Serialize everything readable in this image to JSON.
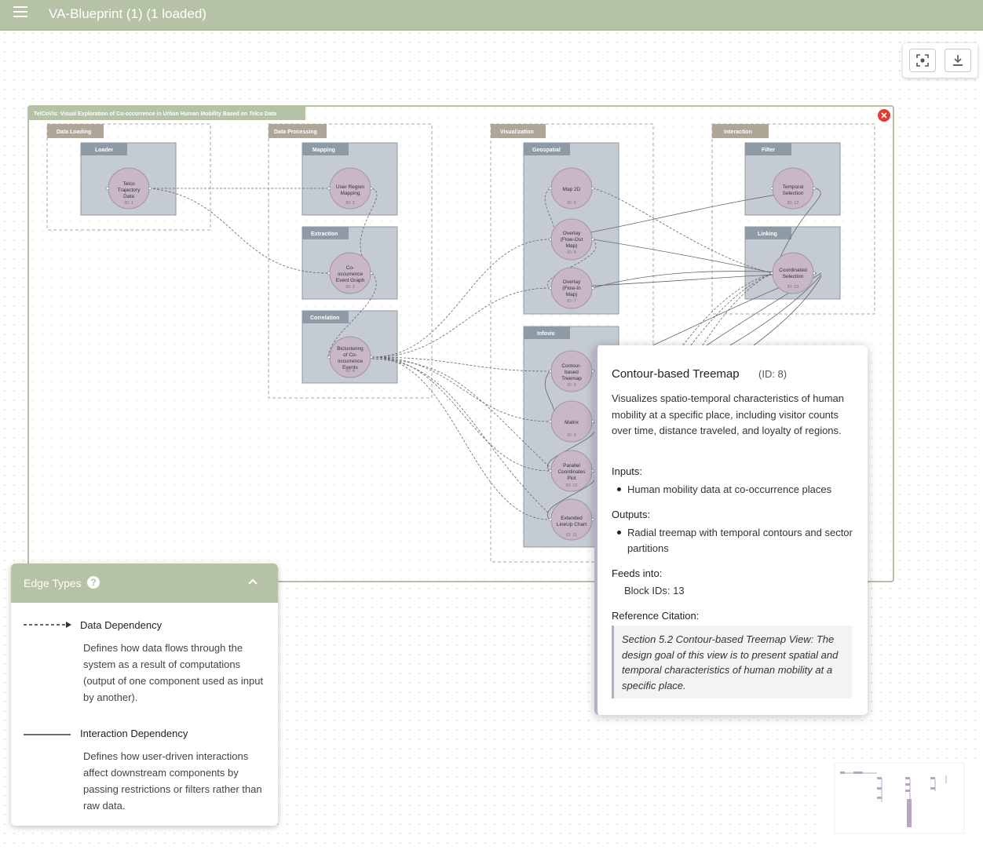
{
  "app": {
    "title": "VA-Blueprint (1) (1 loaded)"
  },
  "toolbar": {
    "fit_view_icon": "fit-view-icon",
    "download_icon": "download-icon"
  },
  "blueprint": {
    "title": "TelCoVis: Visual Exploration of Co-occurrence in Urban Human Mobility Based on Telco Data",
    "stages": {
      "data_loading": "Data Loading",
      "data_processing": "Data Processing",
      "visualization": "Visualization",
      "interaction": "Interaction"
    },
    "groups": {
      "loader": "Loader",
      "mapping": "Mapping",
      "extraction": "Extraction",
      "correlation": "Correlation",
      "geospatial": "Geospatial",
      "infovis": "Infovis",
      "filter": "Filter",
      "linking": "Linking"
    },
    "nodes": {
      "n1": {
        "lines": [
          "Telco",
          "Trajectory",
          "Data"
        ],
        "id": "ID: 1"
      },
      "n2": {
        "lines": [
          "User Region",
          "Mapping"
        ],
        "id": "ID: 2"
      },
      "n3": {
        "lines": [
          "Co-",
          "occurrence",
          "Event Graph"
        ],
        "id": "ID: 3"
      },
      "n4": {
        "lines": [
          "Biclustering",
          "of Co-",
          "occurrence",
          "Events"
        ],
        "id": "ID: 4"
      },
      "n5": {
        "lines": [
          "Map 2D"
        ],
        "id": "ID: 5"
      },
      "n6": {
        "lines": [
          "Overlay",
          "(Flow-Out",
          "Map)"
        ],
        "id": "ID: 6"
      },
      "n7": {
        "lines": [
          "Overlay",
          "(Flow-In",
          "Map)"
        ],
        "id": "ID: 7"
      },
      "n8": {
        "lines": [
          "Contour-",
          "based",
          "Treemap"
        ],
        "id": "ID: 8"
      },
      "n9": {
        "lines": [
          "Matrix"
        ],
        "id": "ID: 9"
      },
      "n10": {
        "lines": [
          "Parallel",
          "Coordinates",
          "Plot"
        ],
        "id": "ID: 10"
      },
      "n11": {
        "lines": [
          "Extended",
          "LineUp Chart"
        ],
        "id": "ID: 11"
      },
      "n12": {
        "lines": [
          "Temporal",
          "Selection"
        ],
        "id": "ID: 12"
      },
      "n13": {
        "lines": [
          "Coordinated",
          "Selection"
        ],
        "id": "ID: 13"
      }
    },
    "colors": {
      "frame": "#b6c2a5",
      "stage_tab": "#b0a697",
      "group_tab": "#8e9ba6",
      "group_fill": "#c5cbd2",
      "node_fill": "#c8b6c9"
    }
  },
  "legend": {
    "title": "Edge Types",
    "data_dependency": {
      "name": "Data Dependency",
      "description": "Defines how data flows through the system as a result of computations (output of one component used as input by another)."
    },
    "interaction_dependency": {
      "name": "Interaction Dependency",
      "description": "Defines how user-driven interactions affect downstream components by passing restrictions or filters rather than raw data."
    }
  },
  "tooltip": {
    "title": "Contour-based Treemap",
    "id": "(ID: 8)",
    "description": "Visualizes spatio-temporal characteristics of human mobility at a specific place, including visitor counts over time, distance traveled, and loyalty of regions.",
    "inputs_label": "Inputs:",
    "inputs": [
      "Human mobility data at co-occurrence places"
    ],
    "outputs_label": "Outputs:",
    "outputs": [
      "Radial treemap with temporal contours and sector partitions"
    ],
    "feeds_label": "Feeds into:",
    "feeds": "Block IDs: 13",
    "citation_label": "Reference Citation:",
    "citation": "Section 5.2 Contour-based Treemap View: The design goal of this view is to present spatial and temporal characteristics of human mobility at a specific place."
  }
}
